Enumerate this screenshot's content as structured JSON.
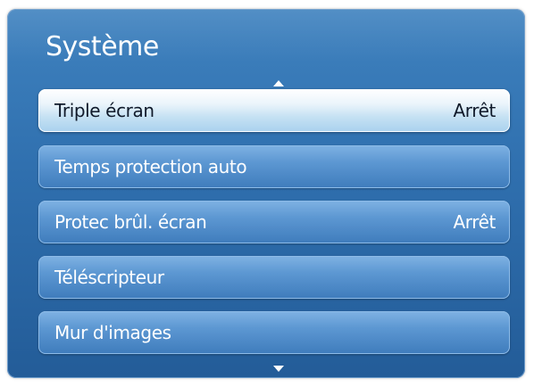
{
  "menu": {
    "title": "Système",
    "items": [
      {
        "label": "Triple écran",
        "value": "Arrêt",
        "selected": true
      },
      {
        "label": "Temps protection auto",
        "value": ""
      },
      {
        "label": "Protec brûl. écran",
        "value": "Arrêt"
      },
      {
        "label": "Téléscripteur",
        "value": ""
      },
      {
        "label": "Mur d'images",
        "value": ""
      }
    ]
  },
  "icons": {
    "scroll_up": "triangle-up-icon",
    "scroll_down": "triangle-down-icon"
  },
  "colors": {
    "panel": "#2f6fae",
    "item": "#5c97d2",
    "selected_item": "#c5e1f3",
    "text": "#ffffff",
    "selected_text": "#101a2a"
  }
}
